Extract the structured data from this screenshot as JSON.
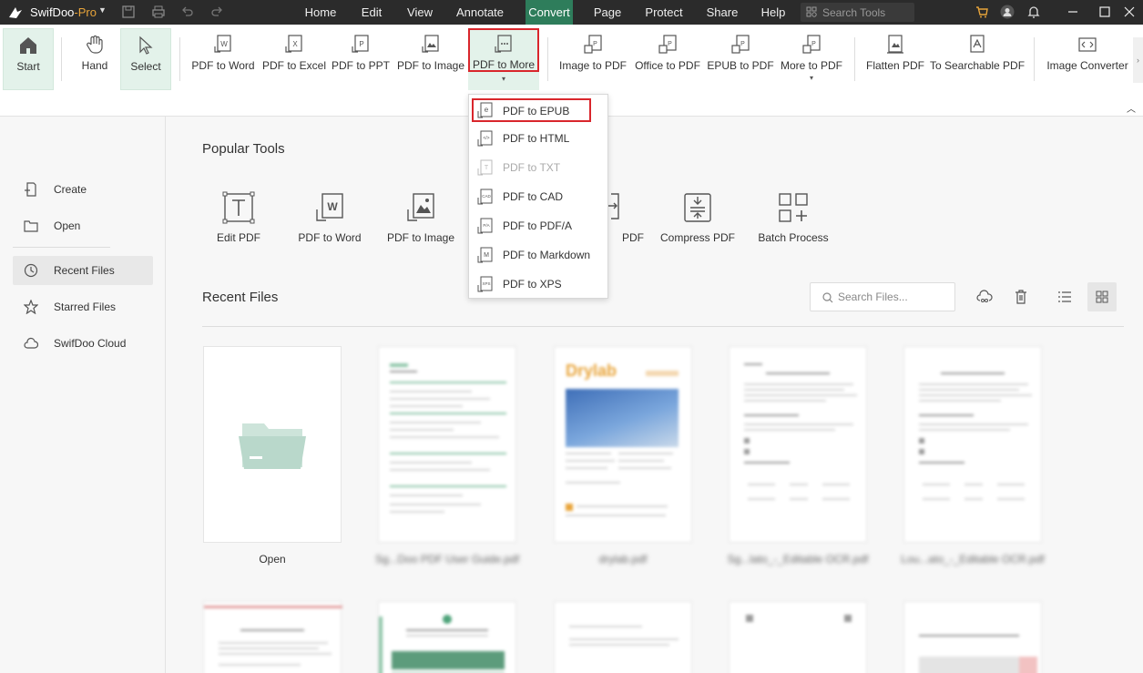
{
  "app": {
    "name": "SwifDoo",
    "edition": "-Pro"
  },
  "menu": {
    "items": [
      {
        "label": "Home"
      },
      {
        "label": "Edit"
      },
      {
        "label": "View"
      },
      {
        "label": "Annotate"
      },
      {
        "label": "Convert",
        "active": true
      },
      {
        "label": "Page"
      },
      {
        "label": "Protect"
      },
      {
        "label": "Share"
      },
      {
        "label": "Help"
      }
    ],
    "search_placeholder": "Search Tools"
  },
  "ribbon": {
    "start": "Start",
    "hand": "Hand",
    "select": "Select",
    "pdf_to_word": "PDF to Word",
    "pdf_to_excel": "PDF to Excel",
    "pdf_to_ppt": "PDF to PPT",
    "pdf_to_image": "PDF to Image",
    "pdf_to_more": "PDF to More",
    "image_to_pdf": "Image to PDF",
    "office_to_pdf": "Office to PDF",
    "epub_to_pdf": "EPUB to PDF",
    "more_to_pdf": "More to PDF",
    "flatten_pdf": "Flatten PDF",
    "to_searchable_pdf": "To Searchable PDF",
    "image_converter": "Image Converter"
  },
  "dropdown": {
    "items": [
      {
        "label": "PDF to EPUB",
        "icon": "epub-icon"
      },
      {
        "label": "PDF to HTML",
        "icon": "html-icon"
      },
      {
        "label": "PDF to TXT",
        "icon": "txt-icon",
        "disabled": true
      },
      {
        "label": "PDF to CAD",
        "icon": "cad-icon"
      },
      {
        "label": "PDF to PDF/A",
        "icon": "pdfa-icon"
      },
      {
        "label": "PDF to Markdown",
        "icon": "markdown-icon"
      },
      {
        "label": "PDF to XPS",
        "icon": "xps-icon"
      }
    ]
  },
  "sidebar": {
    "items": [
      {
        "label": "Create",
        "icon": "create-icon"
      },
      {
        "label": "Open",
        "icon": "folder-icon"
      },
      {
        "label": "Recent Files",
        "icon": "clock-icon",
        "active": true
      },
      {
        "label": "Starred Files",
        "icon": "star-icon"
      },
      {
        "label": "SwifDoo Cloud",
        "icon": "cloud-icon"
      }
    ]
  },
  "popular": {
    "title": "Popular Tools",
    "tools": [
      {
        "label": "Edit PDF"
      },
      {
        "label": "PDF to Word"
      },
      {
        "label": "PDF to Image"
      },
      {
        "label": "PDF"
      },
      {
        "label": "Compress PDF"
      },
      {
        "label": "Batch Process"
      }
    ]
  },
  "recent": {
    "title": "Recent Files",
    "search_placeholder": "Search Files...",
    "open_label": "Open",
    "files": [
      {
        "name": "Sg...Doo PDF User Guide.pdf"
      },
      {
        "name": "drylab.pdf",
        "thumb_text": "Drylab"
      },
      {
        "name": "Sg...lato_-_Editable OCR.pdf"
      },
      {
        "name": "Lou...ato_-_Editable OCR.pdf"
      }
    ]
  },
  "colors": {
    "accent": "#2e7d5b",
    "highlight": "#d9262c",
    "selected_bg": "#e3f2ea"
  }
}
